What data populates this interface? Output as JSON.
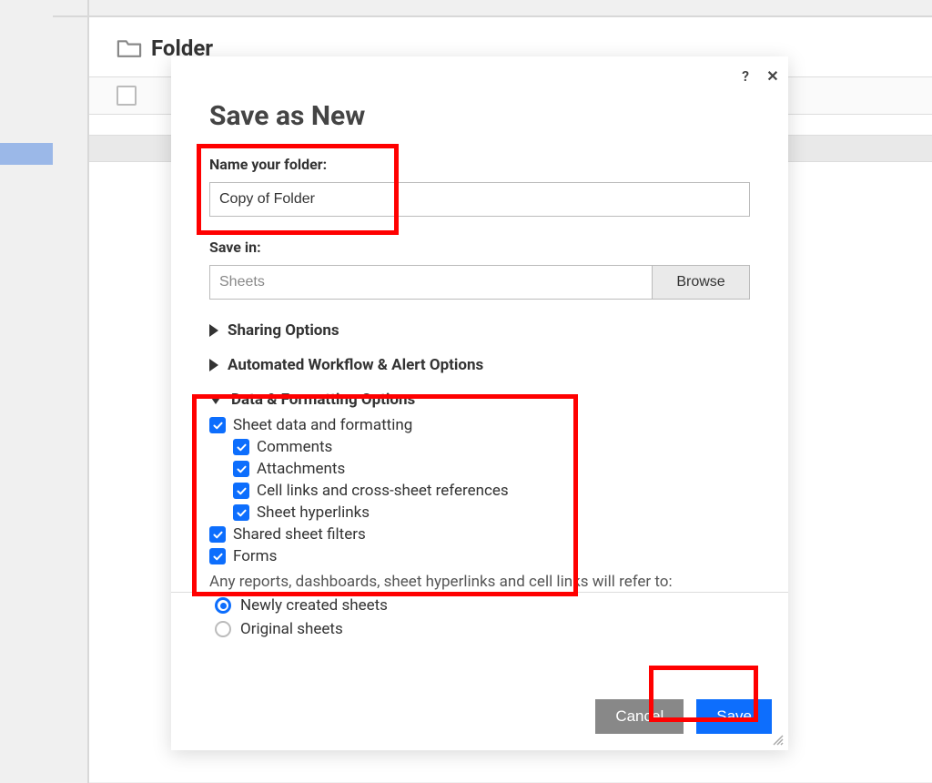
{
  "background": {
    "folder_title": "Folder"
  },
  "modal": {
    "title": "Save as New",
    "name_label": "Name your folder:",
    "name_value": "Copy of Folder",
    "save_in_label": "Save in:",
    "save_in_value": "Sheets",
    "browse_label": "Browse",
    "sections": {
      "sharing": "Sharing Options",
      "workflow": "Automated Workflow & Alert Options",
      "data_fmt": "Data & Formatting Options"
    },
    "checkboxes": {
      "sheet_data": "Sheet data and formatting",
      "comments": "Comments",
      "attachments": "Attachments",
      "cell_links": "Cell links and cross-sheet references",
      "hyperlinks": "Sheet hyperlinks",
      "shared_filters": "Shared sheet filters",
      "forms": "Forms"
    },
    "refer_note": "Any reports, dashboards, sheet hyperlinks and cell links will refer to:",
    "radios": {
      "newly": "Newly created sheets",
      "original": "Original sheets"
    },
    "buttons": {
      "cancel": "Cancel",
      "save": "Save"
    }
  }
}
